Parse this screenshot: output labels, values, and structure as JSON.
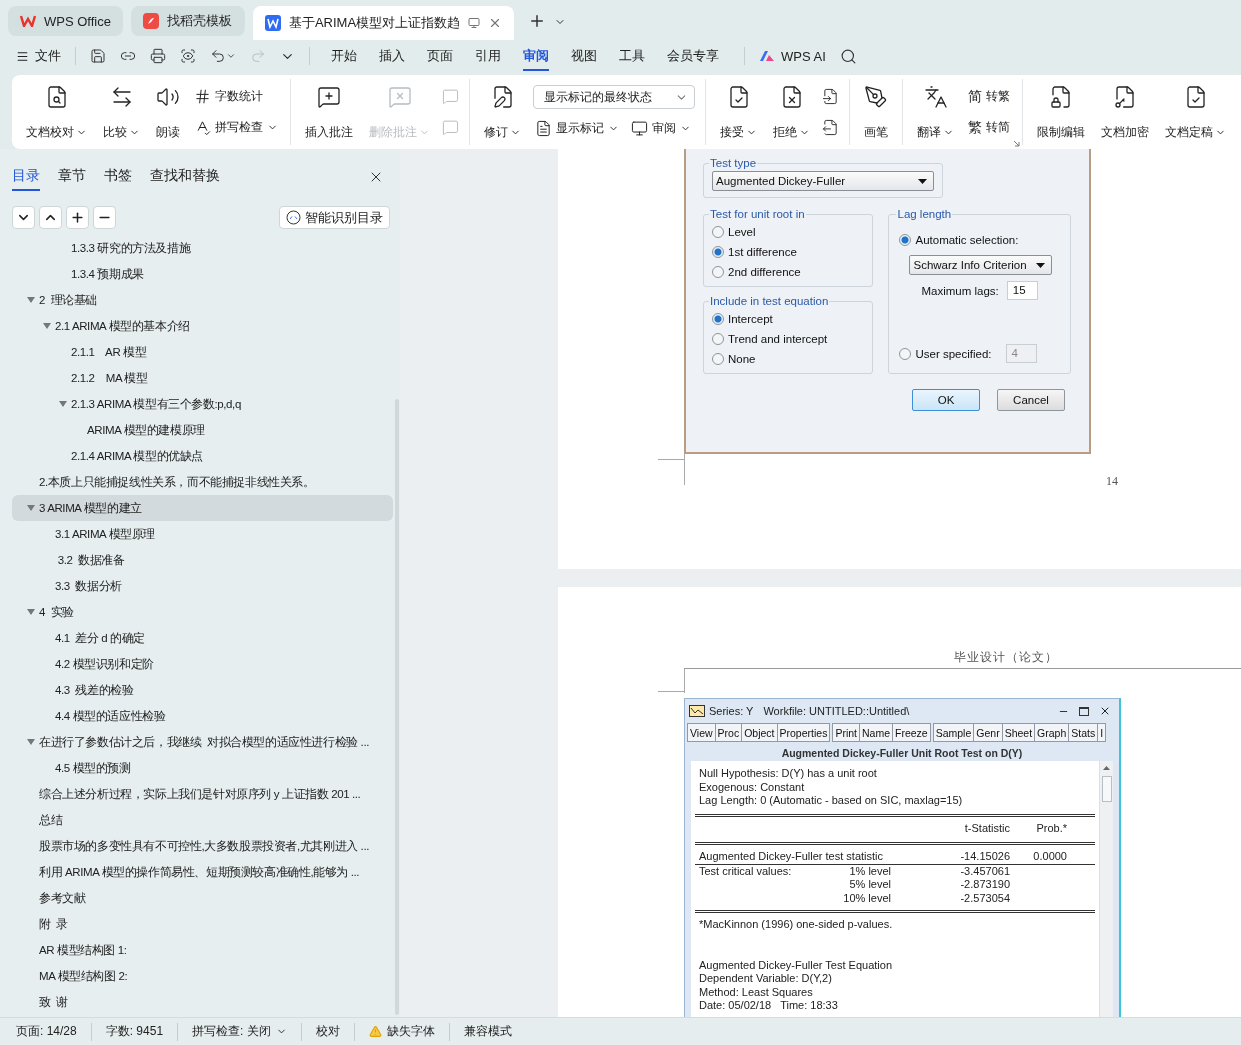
{
  "app_tabs": [
    {
      "label": "WPS Office",
      "selected": false
    },
    {
      "label": "找稻壳模板",
      "selected": false
    },
    {
      "label": "基于ARIMA模型对上证指数趋",
      "selected": true
    }
  ],
  "menu": {
    "file": "文件",
    "tabs": [
      {
        "label": "开始",
        "selected": false
      },
      {
        "label": "插入",
        "selected": false
      },
      {
        "label": "页面",
        "selected": false
      },
      {
        "label": "引用",
        "selected": false
      },
      {
        "label": "审阅",
        "selected": true
      },
      {
        "label": "视图",
        "selected": false
      },
      {
        "label": "工具",
        "selected": false
      },
      {
        "label": "会员专享",
        "selected": false
      }
    ],
    "ai": "WPS AI"
  },
  "ribbon": [
    {
      "launcher": false,
      "items": [
        {
          "kind": "large",
          "label": "文档校对",
          "dropdown": true,
          "disabled": false
        },
        {
          "kind": "large",
          "label": "比较",
          "dropdown": true,
          "disabled": false
        },
        {
          "kind": "large",
          "label": "朗读",
          "dropdown": false,
          "disabled": false
        },
        {
          "kind": "stack",
          "buttons": [
            {
              "label": "字数统计",
              "dropdown": false,
              "disabled": false
            },
            {
              "label": "拼写检查",
              "dropdown": true,
              "disabled": false
            }
          ]
        }
      ]
    },
    {
      "launcher": false,
      "items": [
        {
          "kind": "large",
          "label": "插入批注",
          "dropdown": false,
          "disabled": false
        },
        {
          "kind": "large",
          "label": "删除批注",
          "dropdown": true,
          "disabled": true
        },
        {
          "kind": "stack",
          "buttons": [
            {
              "disabled": true
            },
            {
              "disabled": true
            }
          ]
        }
      ]
    },
    {
      "launcher": false,
      "items": [
        {
          "kind": "large",
          "label": "修订",
          "dropdown": true,
          "disabled": false
        },
        {
          "kind": "select_stack",
          "select": "显示标记的最终状态",
          "buttons": [
            {
              "label": "显示标记",
              "dropdown": true,
              "disabled": false
            },
            {
              "label": "审阅",
              "dropdown": true,
              "disabled": false
            }
          ]
        }
      ]
    },
    {
      "launcher": false,
      "items": [
        {
          "kind": "large",
          "label": "接受",
          "dropdown": true,
          "disabled": false
        },
        {
          "kind": "large",
          "label": "拒绝",
          "dropdown": true,
          "disabled": false
        },
        {
          "kind": "stack",
          "buttons": [
            {
              "disabled": false
            },
            {
              "disabled": false
            }
          ]
        }
      ]
    },
    {
      "launcher": false,
      "items": [
        {
          "kind": "large",
          "label": "画笔",
          "dropdown": false,
          "disabled": false
        }
      ]
    },
    {
      "launcher": true,
      "items": [
        {
          "kind": "large",
          "label": "翻译",
          "dropdown": true,
          "disabled": false
        },
        {
          "kind": "stack",
          "buttons": [
            {
              "glyph": "简",
              "label": "转繁",
              "dropdown": false,
              "disabled": false
            },
            {
              "glyph": "繁",
              "label": "转简",
              "dropdown": false,
              "disabled": false
            }
          ]
        }
      ]
    },
    {
      "launcher": false,
      "items": [
        {
          "kind": "large",
          "label": "限制编辑",
          "dropdown": false,
          "disabled": false
        },
        {
          "kind": "large",
          "label": "文档加密",
          "dropdown": false,
          "disabled": false
        },
        {
          "kind": "large",
          "label": "文档定稿",
          "dropdown": true,
          "disabled": false
        }
      ]
    }
  ],
  "sidebar": {
    "tabs": [
      {
        "label": "目录",
        "selected": true
      },
      {
        "label": "章节",
        "selected": false
      },
      {
        "label": "书签",
        "selected": false
      },
      {
        "label": "查找和替换",
        "selected": false
      }
    ],
    "smart_button": "智能识别目录",
    "toc": [
      {
        "children": [
          {
            "children": [
              {
                "label": "1.3.3 研究的方法及措施",
                "selected": false
              },
              {
                "label": "1.3.4 预期成果",
                "selected": false
              }
            ]
          }
        ]
      },
      {
        "label": "2  理论基础",
        "selected": false,
        "expanded": true,
        "children": [
          {
            "label": "2.1 ARIMA 模型的基本介绍",
            "selected": false,
            "expanded": true,
            "children": [
              {
                "label": "2.1.1    AR 模型",
                "selected": false
              },
              {
                "label": "2.1.2    MA 模型",
                "selected": false
              },
              {
                "label": "2.1.3 ARIMA 模型有三个参数:p,d,q",
                "selected": false,
                "expanded": true,
                "children": [
                  {
                    "label": "ARIMA 模型的建模原理",
                    "selected": false
                  }
                ]
              },
              {
                "label": "2.1.4 ARIMA 模型的优缺点",
                "selected": false
              }
            ]
          }
        ]
      },
      {
        "label": "2.本质上只能捕捉线性关系，而不能捕捉非线性关系。",
        "selected": false
      },
      {
        "label": "3 ARIMA 模型的建立",
        "selected": true,
        "expanded": true,
        "children": [
          {
            "label": "3.1 ARIMA 模型原理",
            "selected": false
          },
          {
            "label": " 3.2  数据准备",
            "selected": false
          },
          {
            "label": "3.3  数据分析",
            "selected": false
          }
        ]
      },
      {
        "label": "4  实验",
        "selected": false,
        "expanded": true,
        "children": [
          {
            "label": "4.1  差分 d 的确定",
            "selected": false
          },
          {
            "label": "4.2 模型识别和定阶",
            "selected": false
          },
          {
            "label": "4.3  残差的检验",
            "selected": false
          },
          {
            "label": "4.4 模型的适应性检验",
            "selected": false
          }
        ]
      },
      {
        "label": "在进行了参数估计之后，我继续  对拟合模型的适应性进行检验 ...",
        "selected": false,
        "expanded": true,
        "children": [
          {
            "label": "4.5 模型的预测",
            "selected": false
          }
        ]
      },
      {
        "label": "综合上述分析过程，实际上我们是针对原序列 y 上证指数 201 ...",
        "selected": false
      },
      {
        "label": "总结",
        "selected": false
      },
      {
        "label": "股票市场的多变性具有不可控性,大多数股票投资者,尤其刚进入 ...",
        "selected": false
      },
      {
        "label": "利用 ARIMA 模型的操作简易性、短期预测较高准确性,能够为 ...",
        "selected": false
      },
      {
        "label": "参考文献",
        "selected": false
      },
      {
        "label": "附  录",
        "selected": false
      },
      {
        "label": "AR 模型结构图 1:",
        "selected": false
      },
      {
        "label": "MA 模型结构图 2:",
        "selected": false
      },
      {
        "label": "致  谢",
        "selected": false
      }
    ]
  },
  "dialog": {
    "test_type": {
      "title": "Test type",
      "value": "Augmented Dickey-Fuller"
    },
    "unit_root": {
      "title": "Test for unit root in",
      "options": [
        {
          "label": "Level",
          "selected": false
        },
        {
          "label": "1st difference",
          "selected": true
        },
        {
          "label": "2nd difference",
          "selected": false
        }
      ]
    },
    "include": {
      "title": "Include in test equation",
      "options": [
        {
          "label": "Intercept",
          "selected": true
        },
        {
          "label": "Trend and intercept",
          "selected": false
        },
        {
          "label": "None",
          "selected": false
        }
      ]
    },
    "lag": {
      "title": "Lag length",
      "automatic": {
        "label": "Automatic selection:",
        "selected": true
      },
      "criterion": "Schwarz Info Criterion",
      "max_label": "Maximum lags:",
      "max_value": "15",
      "user": {
        "label": "User specified:",
        "selected": false
      },
      "user_value": "4"
    },
    "buttons": [
      {
        "label": "OK",
        "default": true
      },
      {
        "label": "Cancel",
        "default": false
      }
    ]
  },
  "page_number": "14",
  "page_header": "毕业设计（论文）",
  "eviews": {
    "title": [
      "Series: Y",
      "Workfile: UNTITLED::Untitled\\"
    ],
    "toolbar": [
      [
        "View",
        "Proc",
        "Object",
        "Properties"
      ],
      [
        "Print",
        "Name",
        "Freeze"
      ],
      [
        "Sample",
        "Genr",
        "Sheet",
        "Graph",
        "Stats",
        "I"
      ]
    ],
    "heading": "Augmented Dickey-Fuller Unit Root Test on D(Y)",
    "summary": [
      "Null Hypothesis: D(Y) has a unit root",
      "Exogenous: Constant",
      "Lag Length: 0 (Automatic - based on SIC, maxlag=15)"
    ],
    "columns": [
      "t-Statistic",
      "Prob.*"
    ],
    "rows": [
      {
        "label": "Augmented Dickey-Fuller test statistic",
        "t": "-14.15026",
        "prob": "0.0000"
      },
      {
        "label": "Test critical values:",
        "sub": "1% level",
        "t": "-3.457061"
      },
      {
        "sub": "5% level",
        "t": "-2.873190"
      },
      {
        "sub": "10% level",
        "t": "-2.573054"
      }
    ],
    "note": "*MacKinnon (1996) one-sided p-values.",
    "equation": [
      "Augmented Dickey-Fuller Test Equation",
      "Dependent Variable: D(Y,2)",
      "Method: Least Squares",
      "Date: 05/02/18   Time: 18:33"
    ]
  },
  "status": [
    {
      "kind": "text",
      "text": "页面: 14/28"
    },
    {
      "kind": "text",
      "text": "字数: 9451"
    },
    {
      "kind": "dropdown",
      "text": "拼写检查: 关闭"
    },
    {
      "kind": "text",
      "text": "校对"
    },
    {
      "kind": "warning",
      "text": "缺失字体"
    },
    {
      "kind": "text",
      "text": "兼容模式"
    }
  ]
}
